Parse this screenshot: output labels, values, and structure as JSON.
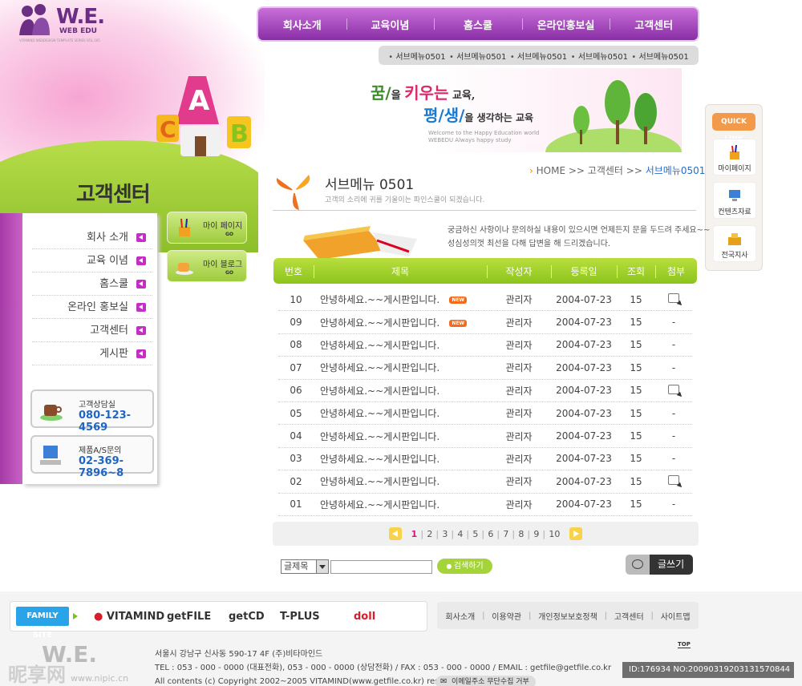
{
  "logo": {
    "main": "W.E.",
    "sub": "WEB EDU",
    "tiny": "VITAMIND WEBDESIGN TEMPLATE SERIES VOL.165"
  },
  "hero": {
    "section_title": "고객센터"
  },
  "top_nav": [
    "회사소개",
    "교육이념",
    "홈스쿨",
    "온라인홍보실",
    "고객센터"
  ],
  "sub_nav": [
    "서브메뉴0501",
    "서브메뉴0501",
    "서브메뉴0501",
    "서브메뉴0501",
    "서브메뉴0501"
  ],
  "slogan": {
    "line1_a": "꿈/",
    "line1_b": "을 ",
    "line1_c": "키우는",
    "line1_d": " 교육,",
    "line2_a": "평/생/",
    "line2_b": "을 생각하는 교육",
    "en1": "Welcome to the Happy Education world",
    "en2": "WEBEDU Always happy study"
  },
  "quick_link": {
    "title": "QUICK LINK",
    "items": [
      "마이페이지",
      "컨텐츠자료",
      "전국지사"
    ]
  },
  "left_nav": [
    "회사 소개",
    "교육 이념",
    "홈스쿨",
    "온라인 홍보실",
    "고객센터",
    "게시판"
  ],
  "mini_buttons": [
    {
      "label": "마이 페이지",
      "go": "GO"
    },
    {
      "label": "마이 블로그",
      "go": "GO"
    }
  ],
  "contact": [
    {
      "label": "고객상담실",
      "tel": "080-123-4569"
    },
    {
      "label": "제품A/S문의",
      "tel": "02-369-7896~8"
    }
  ],
  "page": {
    "title": "서브메뉴 0501",
    "desc": "고객의 소리에 귀를 기울이는 파인스쿨이 되겠습니다.",
    "breadcrumb": {
      "home": "HOME",
      "sep": " >> ",
      "mid": "고객센터",
      "current": "서브메뉴0501"
    },
    "intro_line1": "궁금하신 사항이나 문의하실 내용이 있으시면 언제든지 문을 두드려 주세요~~",
    "intro_line2": "성심성의껏 최선을 다해 답변을 해 드리겠습니다."
  },
  "board": {
    "columns": [
      "번호",
      "제목",
      "작성자",
      "등록일",
      "조회",
      "첨부"
    ],
    "new_label": "NEW",
    "rows": [
      {
        "no": "10",
        "title": "안녕하세요.~~게시판입니다.",
        "new": true,
        "author": "관리자",
        "date": "2004-07-23",
        "views": "15",
        "attach": "icon"
      },
      {
        "no": "09",
        "title": "안녕하세요.~~게시판입니다.",
        "new": true,
        "author": "관리자",
        "date": "2004-07-23",
        "views": "15",
        "attach": "-"
      },
      {
        "no": "08",
        "title": "안녕하세요.~~게시판입니다.",
        "new": false,
        "author": "관리자",
        "date": "2004-07-23",
        "views": "15",
        "attach": "-"
      },
      {
        "no": "07",
        "title": "안녕하세요.~~게시판입니다.",
        "new": false,
        "author": "관리자",
        "date": "2004-07-23",
        "views": "15",
        "attach": "-"
      },
      {
        "no": "06",
        "title": "안녕하세요.~~게시판입니다.",
        "new": false,
        "author": "관리자",
        "date": "2004-07-23",
        "views": "15",
        "attach": "icon"
      },
      {
        "no": "05",
        "title": "안녕하세요.~~게시판입니다.",
        "new": false,
        "author": "관리자",
        "date": "2004-07-23",
        "views": "15",
        "attach": "-"
      },
      {
        "no": "04",
        "title": "안녕하세요.~~게시판입니다.",
        "new": false,
        "author": "관리자",
        "date": "2004-07-23",
        "views": "15",
        "attach": "-"
      },
      {
        "no": "03",
        "title": "안녕하세요.~~게시판입니다.",
        "new": false,
        "author": "관리자",
        "date": "2004-07-23",
        "views": "15",
        "attach": "-"
      },
      {
        "no": "02",
        "title": "안녕하세요.~~게시판입니다.",
        "new": false,
        "author": "관리자",
        "date": "2004-07-23",
        "views": "15",
        "attach": "icon"
      },
      {
        "no": "01",
        "title": "안녕하세요.~~게시판입니다.",
        "new": false,
        "author": "관리자",
        "date": "2004-07-23",
        "views": "15",
        "attach": "-"
      }
    ]
  },
  "pager": {
    "pages": [
      "1",
      "2",
      "3",
      "4",
      "5",
      "6",
      "7",
      "8",
      "9",
      "10"
    ],
    "current": "1"
  },
  "search": {
    "select_value": "글제목",
    "input_value": "",
    "button": "검색하기"
  },
  "write_button": "글쓰기",
  "footer": {
    "family_label": "FAMILY SITE",
    "family_sites": [
      "VITAMIND",
      "getFILE",
      "getCD",
      "T-PLUS",
      "doll"
    ],
    "links": [
      "회사소개",
      "이용약관",
      "개인정보보호정책",
      "고객센터",
      "사이트맵"
    ],
    "logo": "W.E.",
    "address": "서울시 강남구 신사동 590-17 4F (주)비타마인드",
    "tel": "TEL : 053 - 000 - 0000 (대표전화), 053 - 000 - 0000 (상담전화)  /  FAX : 053 - 000 - 0000  /  EMAIL : getfile@getfile.co.kr",
    "copyright": "All contents (c) Copyright 2002~2005 VITAMIND(www.getfile.co.kr) reserved.",
    "mail_refuse": "이메일주소 무단수집 거부",
    "top": "TOP"
  },
  "watermark": {
    "left": "昵享网",
    "left_url": "www.nipic.cn",
    "right": "ID:176934 NO:20090319203131570844"
  },
  "colors": {
    "purple": "#8a2ea6",
    "green": "#9ecb3c",
    "accent_blue": "#1f66c4",
    "pink": "#d0187d"
  }
}
